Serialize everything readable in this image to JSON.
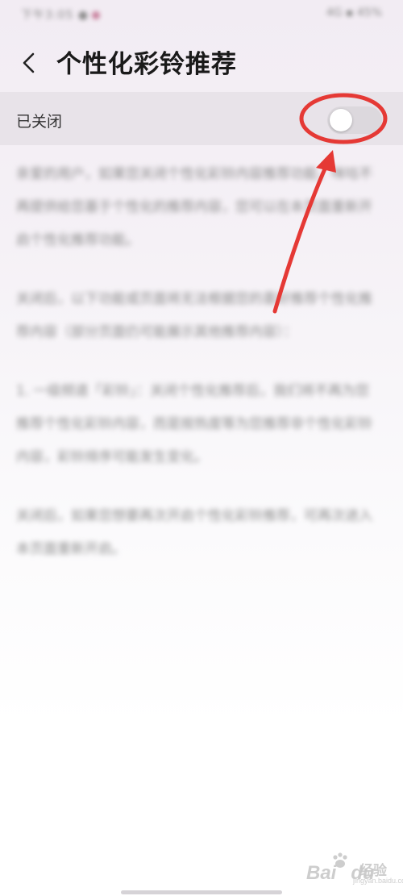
{
  "status_bar": {
    "time_text": "下午3:05 ●",
    "right_text": "4G ▪ 45%"
  },
  "header": {
    "back_icon": "chevron-left-icon",
    "title": "个性化彩铃推荐"
  },
  "toggle": {
    "label": "已关闭",
    "state": "off",
    "highlight_color": "#e53935"
  },
  "content": {
    "paragraphs": [
      "亲爱的用户，如果您关闭个性化彩铃内容推荐功能，咪咕不再提供给您基于个性化的推荐内容，您可以在本页面重新开启个性化推荐功能。",
      "关闭后，以下功能或页面将无法根据您的喜好推荐个性化推荐内容（部分页面仍可能展示其他推荐内容）：",
      "1. 一级频道「彩铃」：关闭个性化推荐后，我们将不再为您推荐个性化彩铃内容，而是按热度等为您推荐非个性化彩铃内容，彩铃排序可能发生变化。",
      "关闭后，如果您想要再次开启个性化彩铃推荐，可再次进入本页面重新开启。"
    ]
  },
  "watermark": {
    "logo": "Bai",
    "logo_tail": "du",
    "text": "经验",
    "sub": "jingyan.baidu.com"
  }
}
